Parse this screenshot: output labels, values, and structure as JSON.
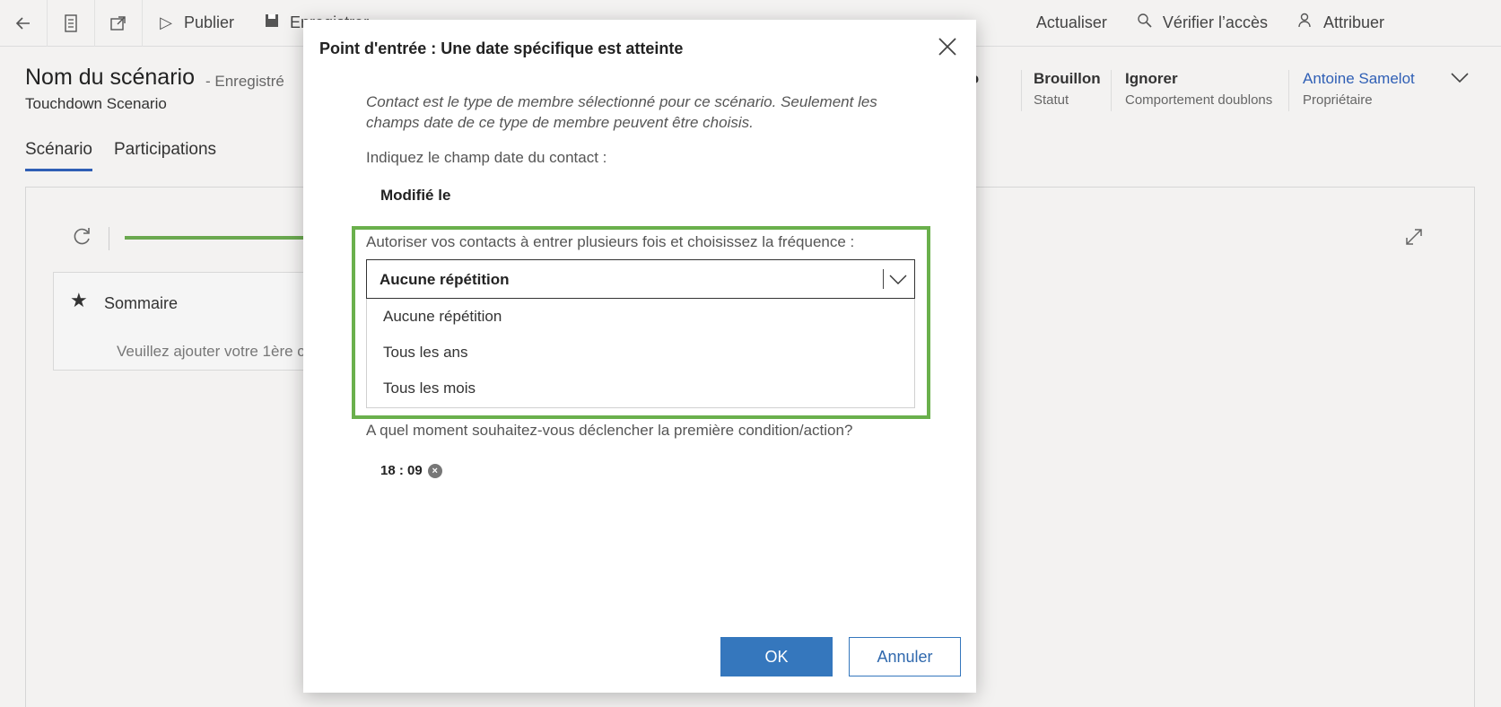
{
  "toolbar": {
    "publish": "Publier",
    "save": "Enregistrer",
    "refresh": "Actualiser",
    "check_access": "Vérifier l’accès",
    "assign": "Attribuer"
  },
  "record": {
    "title": "Nom du scénario",
    "state": "- Enregistré",
    "subtitle": "Touchdown Scenario",
    "tabs": [
      "Scénario",
      "Participations"
    ]
  },
  "header_fields": {
    "type_partial": "ario",
    "status_value": "Brouillon",
    "status_label": "Statut",
    "dup_value": "Ignorer",
    "dup_label": "Comportement doublons",
    "owner_value": "Antoine Samelot",
    "owner_label": "Propriétaire"
  },
  "canvas": {
    "summary_title": "Sommaire",
    "summary_placeholder": "Veuillez ajouter votre 1ère c"
  },
  "dialog": {
    "title": "Point d'entrée : Une date spécifique est atteinte",
    "info": "Contact est le type de membre sélectionné pour ce scénario. Seulement les champs date de ce type de membre peuvent être choisis.",
    "date_field_label": "Indiquez le champ date du contact :",
    "date_field_value": "Modifié le",
    "frequency_label": "Autoriser vos contacts à entrer plusieurs fois et choisissez la fréquence :",
    "frequency_selected": "Aucune répétition",
    "frequency_options": [
      "Aucune répétition",
      "Tous les ans",
      "Tous les mois"
    ],
    "trigger_label": "A quel moment souhaitez-vous déclencher la première condition/action?",
    "trigger_time": "18 : 09",
    "ok_label": "OK",
    "cancel_label": "Annuler",
    "highlight_color": "#6ab04c"
  }
}
